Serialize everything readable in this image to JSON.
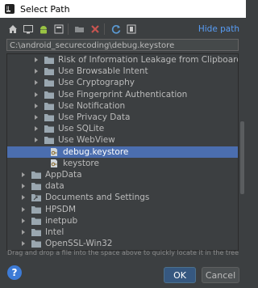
{
  "window": {
    "title": "Select Path"
  },
  "toolbar": {
    "buttons": [
      "home-icon",
      "desktop-icon",
      "android-icon",
      "project-icon",
      "new-folder-icon",
      "delete-icon",
      "refresh-icon",
      "show-hidden-icon"
    ],
    "hide_path_label": "Hide path"
  },
  "path": {
    "value": "C:\\android_securecoding\\debug.keystore"
  },
  "tree": {
    "rows": [
      {
        "label": "Risk of Information Leakage from Clipboard",
        "type": "folder",
        "level": 2,
        "expanded": false,
        "selected": false
      },
      {
        "label": "Use Browsable Intent",
        "type": "folder",
        "level": 2,
        "expanded": false,
        "selected": false
      },
      {
        "label": "Use Cryptography",
        "type": "folder",
        "level": 2,
        "expanded": false,
        "selected": false
      },
      {
        "label": "Use Fingerprint Authentication",
        "type": "folder",
        "level": 2,
        "expanded": false,
        "selected": false
      },
      {
        "label": "Use Notification",
        "type": "folder",
        "level": 2,
        "expanded": false,
        "selected": false
      },
      {
        "label": "Use Privacy Data",
        "type": "folder",
        "level": 2,
        "expanded": false,
        "selected": false
      },
      {
        "label": "Use SQLite",
        "type": "folder",
        "level": 2,
        "expanded": false,
        "selected": false
      },
      {
        "label": "Use WebView",
        "type": "folder",
        "level": 2,
        "expanded": false,
        "selected": false
      },
      {
        "label": "debug.keystore",
        "type": "file",
        "level": 2,
        "expanded": false,
        "selected": true
      },
      {
        "label": "keystore",
        "type": "file",
        "level": 2,
        "expanded": false,
        "selected": false
      },
      {
        "label": "AppData",
        "type": "folder",
        "level": 1,
        "expanded": false,
        "selected": false
      },
      {
        "label": "data",
        "type": "folder",
        "level": 1,
        "expanded": false,
        "selected": false
      },
      {
        "label": "Documents and Settings",
        "type": "folder-link",
        "level": 1,
        "expanded": false,
        "selected": false
      },
      {
        "label": "HPSDM",
        "type": "folder",
        "level": 1,
        "expanded": false,
        "selected": false
      },
      {
        "label": "inetpub",
        "type": "folder",
        "level": 1,
        "expanded": false,
        "selected": false
      },
      {
        "label": "Intel",
        "type": "folder",
        "level": 1,
        "expanded": false,
        "selected": false
      },
      {
        "label": "OpenSSL-Win32",
        "type": "folder",
        "level": 1,
        "expanded": false,
        "selected": false
      }
    ]
  },
  "hint": "Drag and drop a file into the space above to quickly locate it in the tree",
  "buttons": {
    "help": "?",
    "ok": "OK",
    "cancel": "Cancel"
  },
  "colors": {
    "background": "#3c3f41",
    "selection": "#4b6eaf",
    "link": "#589df6",
    "folder": "#9aa7b0",
    "close": "#c75450"
  }
}
